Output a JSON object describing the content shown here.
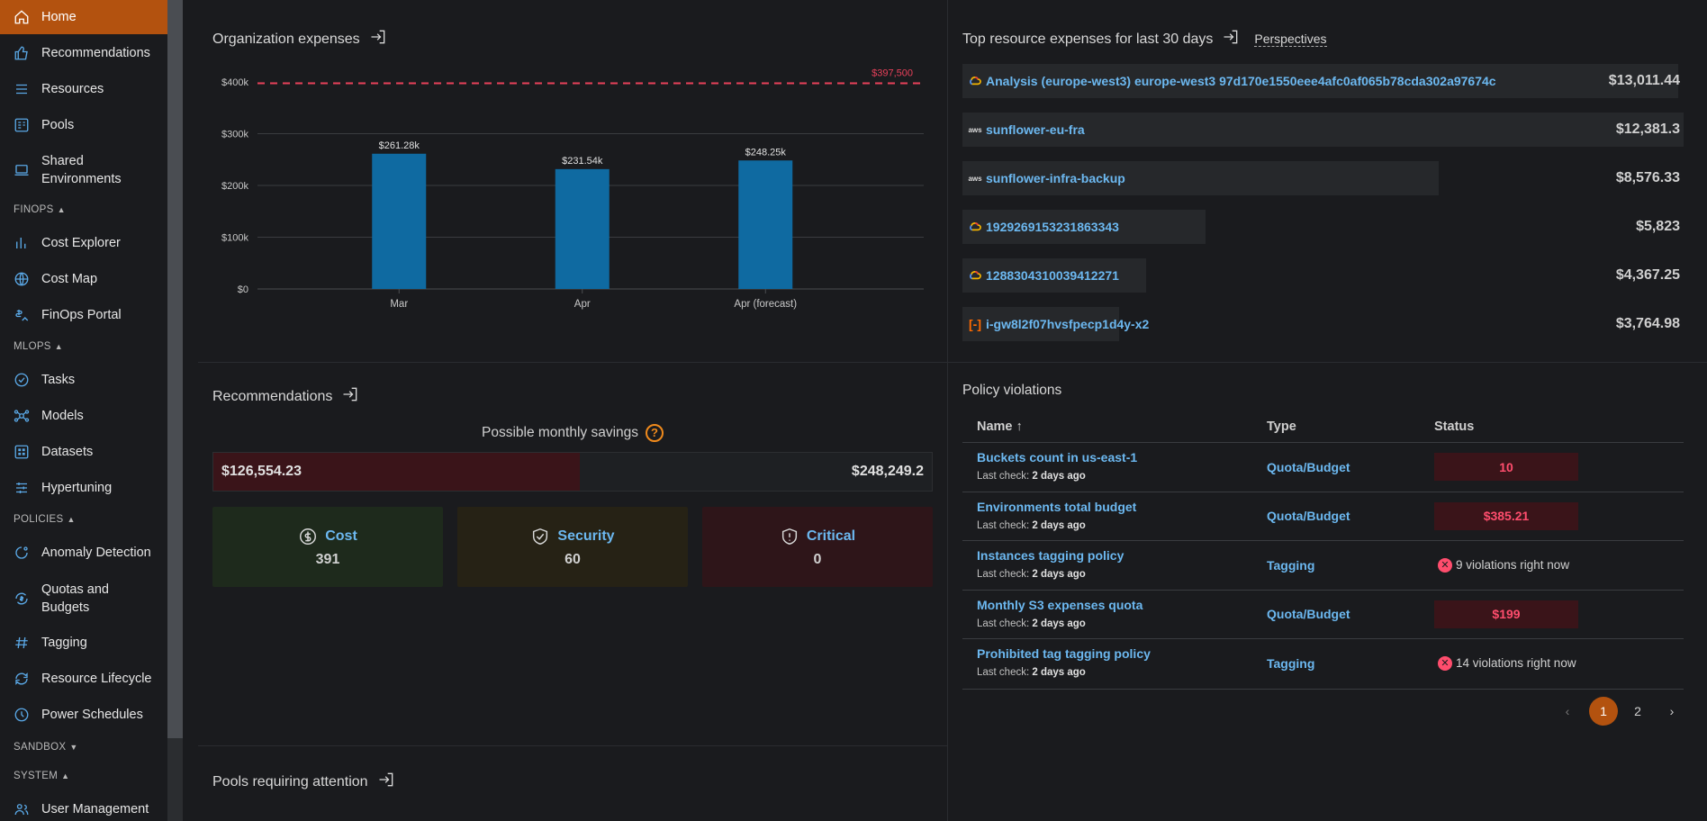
{
  "sidebar": {
    "home": "Home",
    "recommendations": "Recommendations",
    "resources": "Resources",
    "pools": "Pools",
    "shared_env_1": "Shared",
    "shared_env_2": "Environments",
    "finops": "FINOPS",
    "cost_explorer": "Cost Explorer",
    "cost_map": "Cost Map",
    "finops_portal": "FinOps Portal",
    "mlops": "MLOPS",
    "tasks": "Tasks",
    "models": "Models",
    "datasets": "Datasets",
    "hypertuning": "Hypertuning",
    "policies": "POLICIES",
    "anomaly_detection": "Anomaly Detection",
    "quotas_1": "Quotas and",
    "quotas_2": "Budgets",
    "tagging": "Tagging",
    "resource_lifecycle": "Resource Lifecycle",
    "power_schedules": "Power Schedules",
    "sandbox": "SANDBOX",
    "system": "SYSTEM",
    "user_management": "User Management"
  },
  "org_expenses": {
    "title": "Organization expenses"
  },
  "chart_data": {
    "type": "bar",
    "categories": [
      "Mar",
      "Apr",
      "Apr (forecast)"
    ],
    "values": [
      261.28,
      231.54,
      248.25
    ],
    "value_labels": [
      "$261.28k",
      "$231.54k",
      "$248.25k"
    ],
    "y_ticks": [
      "$0",
      "$100k",
      "$200k",
      "$300k",
      "$400k"
    ],
    "ylim": [
      0,
      400
    ],
    "threshold": 397.5,
    "threshold_label": "$397,500",
    "bar_color": "#0f6aa1",
    "threshold_color": "#e8405a"
  },
  "top_resources": {
    "title": "Top resource expenses for last 30 days",
    "perspectives": "Perspectives",
    "items": [
      {
        "icon": "gcp-icon",
        "name": "Analysis (europe-west3) europe-west3 97d170e1550eee4afc0af065b78cda302a97674c",
        "cost": "$13,011.44",
        "share": 1.0
      },
      {
        "icon": "aws-icon",
        "name": "sunflower-eu-fra",
        "cost": "$12,381.3",
        "share": 0.95
      },
      {
        "icon": "aws-icon",
        "name": "sunflower-infra-backup",
        "cost": "$8,576.33",
        "share": 0.66
      },
      {
        "icon": "gcp-icon",
        "name": "192926915323186334​3",
        "cost": "$5,823",
        "share": 0.45
      },
      {
        "icon": "gcp-icon",
        "name": "1288304310039412271",
        "cost": "$4,367.25",
        "share": 0.34
      },
      {
        "icon": "alibaba-icon",
        "name": "i-gw8l2f07hvsfpecp1d4y-x2",
        "cost": "$3,764.98",
        "share": 0.29
      }
    ]
  },
  "recommendations": {
    "title": "Recommendations",
    "savings_label": "Possible monthly savings",
    "savings_value": "$126,554.23",
    "savings_total": "$248,249.2",
    "savings_fraction": 0.51,
    "cards": [
      {
        "label": "Cost",
        "value": "391"
      },
      {
        "label": "Security",
        "value": "60"
      },
      {
        "label": "Critical",
        "value": "0"
      }
    ]
  },
  "policy": {
    "title": "Policy violations",
    "col_name": "Name",
    "col_type": "Type",
    "col_status": "Status",
    "last_check_label": "Last check:",
    "rows": [
      {
        "name": "Buckets count in us-east-1",
        "check": "2 days ago",
        "type": "Quota/Budget",
        "status": "10"
      },
      {
        "name": "Environments total budget",
        "check": "2 days ago",
        "type": "Quota/Budget",
        "status": "$385.21"
      },
      {
        "name": "Instances tagging policy",
        "check": "2 days ago",
        "type": "Tagging",
        "status": "9 violations right now"
      },
      {
        "name": "Monthly S3 expenses quota",
        "check": "2 days ago",
        "type": "Quota/Budget",
        "status": "$199"
      },
      {
        "name": "Prohibited tag tagging policy",
        "check": "2 days ago",
        "type": "Tagging",
        "status": "14 violations right now"
      }
    ],
    "pages": [
      "1",
      "2"
    ]
  },
  "pools": {
    "title": "Pools requiring attention"
  }
}
